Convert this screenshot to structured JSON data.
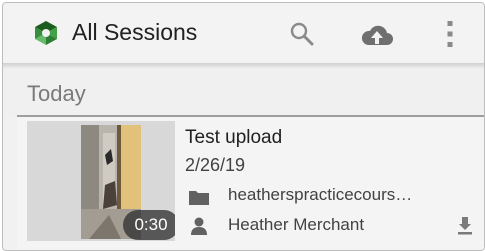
{
  "appbar": {
    "title": "All Sessions",
    "logo_icon": "panopto-logo-icon",
    "search_icon": "search-icon",
    "upload_icon": "cloud-upload-icon",
    "menu_icon": "more-vert-icon",
    "brand_color": "#2e7d32"
  },
  "section": {
    "label": "Today"
  },
  "sessions": [
    {
      "title": "Test upload",
      "date": "2/26/19",
      "folder": "heatherspracticecours…",
      "owner": "Heather Merchant",
      "duration": "0:30",
      "folder_icon": "folder-icon",
      "owner_icon": "person-icon",
      "download_icon": "download-icon"
    }
  ]
}
